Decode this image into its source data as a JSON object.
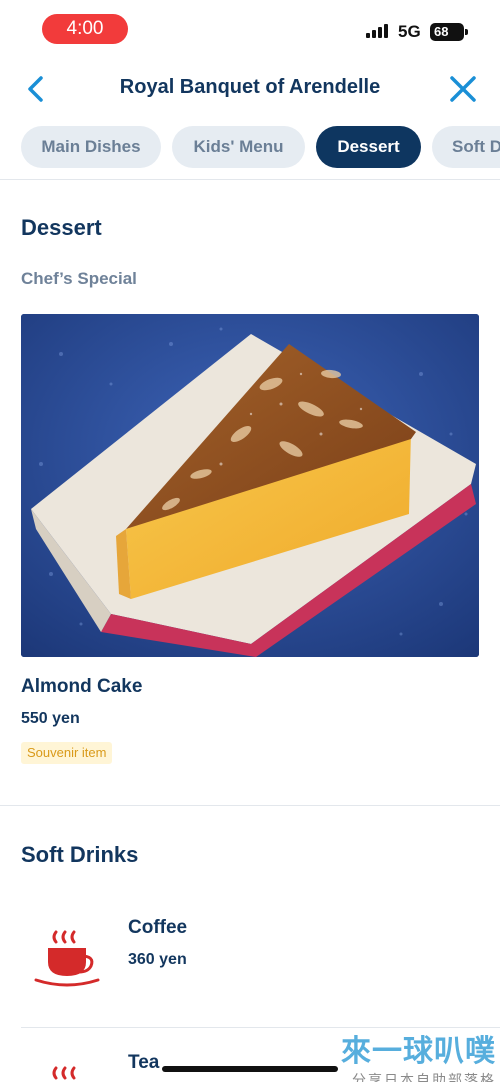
{
  "status_bar": {
    "time": "4:00",
    "network": "5G",
    "battery": "68"
  },
  "nav": {
    "title": "Royal Banquet of Arendelle"
  },
  "tabs": [
    {
      "label": "Main Dishes",
      "active": false
    },
    {
      "label": "Kids' Menu",
      "active": false
    },
    {
      "label": "Dessert",
      "active": true
    },
    {
      "label": "Soft Drinks",
      "active": false
    }
  ],
  "dessert_section": {
    "title": "Dessert",
    "subtitle": "Chef’s Special",
    "item": {
      "name": "Almond Cake",
      "price": "550 yen",
      "badge": "Souvenir item"
    }
  },
  "drinks_section": {
    "title": "Soft Drinks",
    "items": [
      {
        "name": "Coffee",
        "price": "360 yen",
        "icon": "coffee-cup-icon"
      },
      {
        "name": "Tea",
        "price": "",
        "icon": "tea-cup-icon"
      }
    ]
  },
  "watermark": {
    "main": "來一球叭噗",
    "sub": "分享日本自助部落格"
  },
  "colors": {
    "accent": "#1a8fd6",
    "navy": "#0e3660",
    "drink_icon": "#d42a2a",
    "badge_bg": "#fff5d6",
    "badge_text": "#d99a1a"
  }
}
